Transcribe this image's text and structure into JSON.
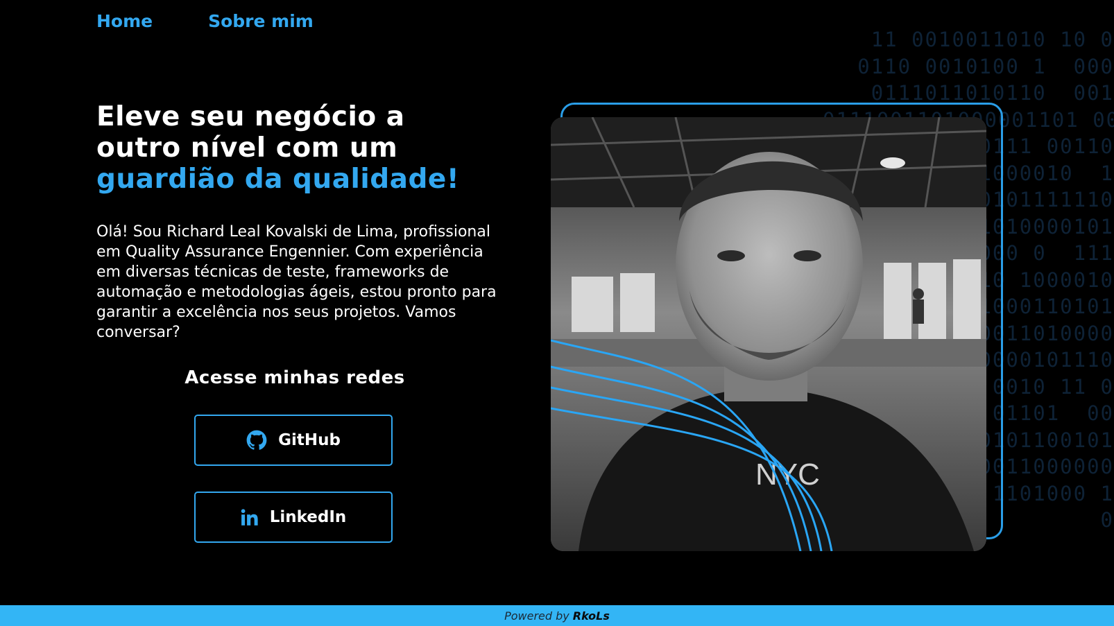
{
  "nav": {
    "home": "Home",
    "about": "Sobre mim"
  },
  "hero": {
    "title_line1": "Eleve seu negócio a",
    "title_line2": "outro nível com um",
    "title_accent": "guardião da qualidade!",
    "intro": "Olá! Sou Richard Leal Kovalski de Lima, profissional em Quality Assurance Engennier. Com experiência em diversas técnicas de teste, frameworks de automação e metodologias ágeis, estou pronto para garantir a excelência nos seus projetos. Vamos conversar?"
  },
  "social": {
    "heading": "Acesse minhas redes",
    "github_label": "GitHub",
    "github_icon": "github-icon",
    "linkedin_label": "LinkedIn",
    "linkedin_icon": "linkedin-icon"
  },
  "profile": {
    "photo_alt": "Foto de perfil",
    "shirt_text": "NYC"
  },
  "footer": {
    "powered_by": "Powered by",
    "brand": "RkoLs"
  },
  "colors": {
    "accent": "#33a8f0",
    "footer_bg": "#33b5f5",
    "background": "#000000"
  }
}
